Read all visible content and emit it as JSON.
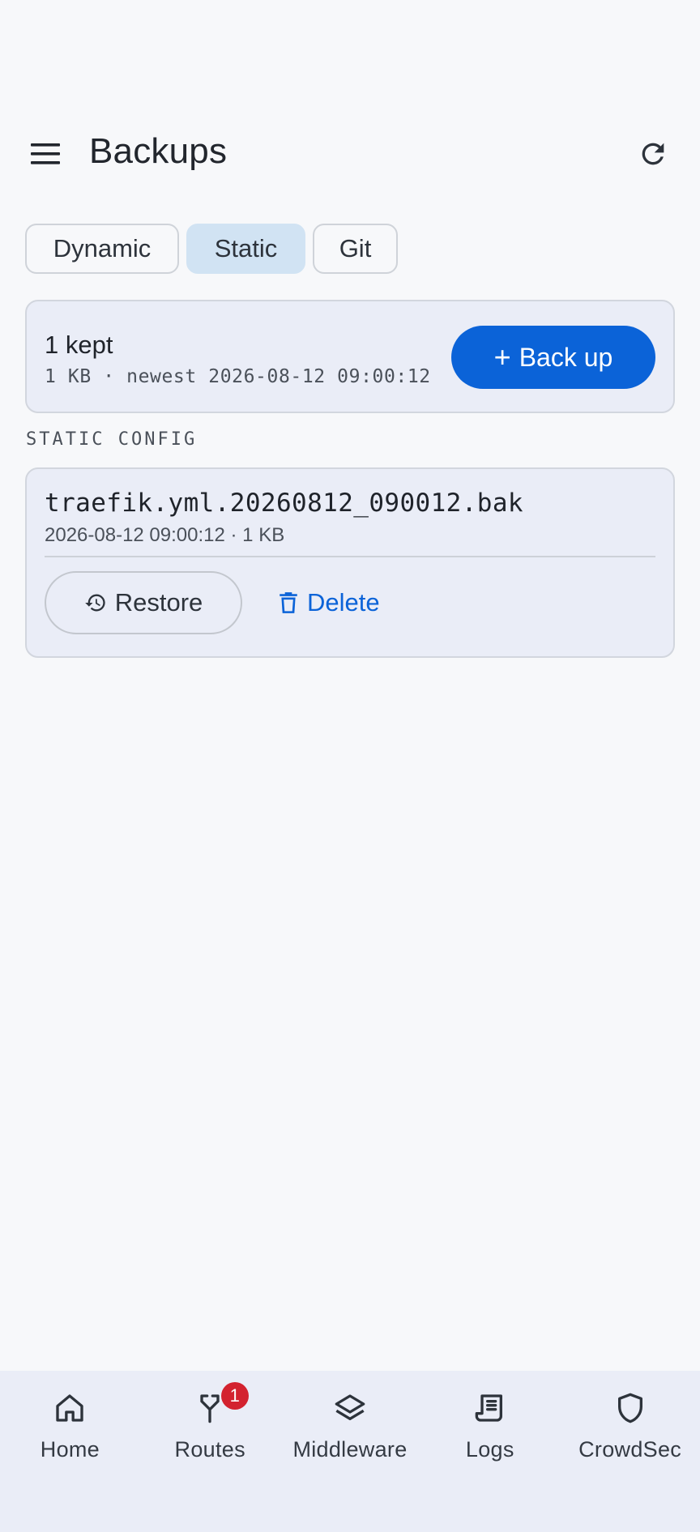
{
  "header": {
    "title": "Backups",
    "menu_icon": "hamburger-menu-icon",
    "refresh_icon": "refresh-icon"
  },
  "tabs": [
    {
      "label": "Dynamic",
      "active": false
    },
    {
      "label": "Static",
      "active": true
    },
    {
      "label": "Git",
      "active": false
    }
  ],
  "summary": {
    "count_text": "1 kept",
    "meta_text": "1 KB · newest 2026-08-12 09:00:12",
    "backup_button_label": "Back up",
    "backup_button_icon": "plus"
  },
  "section": {
    "label": "STATIC CONFIG"
  },
  "backups": [
    {
      "file_name": "traefik.yml.20260812_090012.bak",
      "meta": "2026-08-12 09:00:12 · 1 KB",
      "restore_label": "Restore",
      "delete_label": "Delete"
    }
  ],
  "bottom_nav": [
    {
      "label": "Home",
      "icon": "home-icon"
    },
    {
      "label": "Routes",
      "icon": "routes-icon",
      "badge": "1"
    },
    {
      "label": "Middleware",
      "icon": "layers-icon"
    },
    {
      "label": "Logs",
      "icon": "logs-icon"
    },
    {
      "label": "CrowdSec",
      "icon": "shield-icon"
    }
  ],
  "colors": {
    "accent": "#0b63d8",
    "badge": "#d3222f",
    "active_tab": "#d1e3f3",
    "card": "#eaedf7",
    "background": "#f7f8fa"
  }
}
